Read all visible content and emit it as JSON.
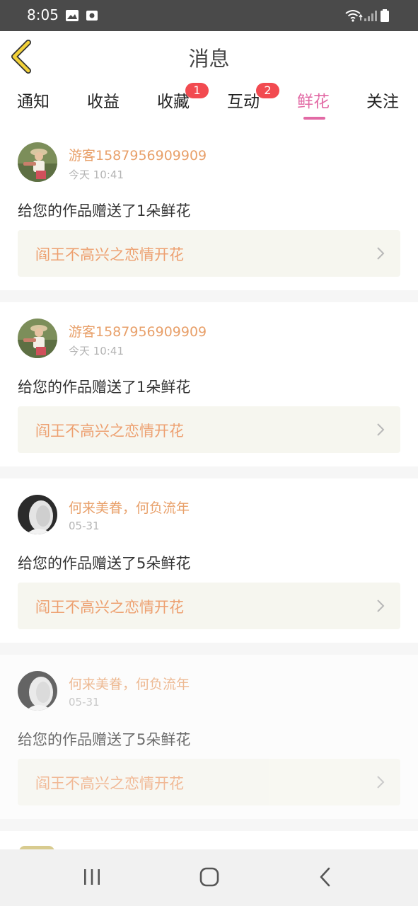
{
  "status_bar": {
    "time": "8:05"
  },
  "header": {
    "title": "消息"
  },
  "tabs": [
    {
      "label": "通知",
      "badge": null
    },
    {
      "label": "收益",
      "badge": null
    },
    {
      "label": "收藏",
      "badge": "1"
    },
    {
      "label": "互动",
      "badge": "2"
    },
    {
      "label": "鲜花",
      "badge": null,
      "active": true
    },
    {
      "label": "关注",
      "badge": null
    }
  ],
  "messages": [
    {
      "username": "游客1587956909909",
      "time": "今天 10:41",
      "text": "给您的作品赠送了1朵鲜花",
      "work_title": "阎王不高兴之恋情开花"
    },
    {
      "username": "游客1587956909909",
      "time": "今天 10:41",
      "text": "给您的作品赠送了1朵鲜花",
      "work_title": "阎王不高兴之恋情开花"
    },
    {
      "username": "何来美眷，何负流年",
      "time": "05-31",
      "text": "给您的作品赠送了5朵鲜花",
      "work_title": "阎王不高兴之恋情开花"
    },
    {
      "username": "何来美眷，何负流年",
      "time": "05-31",
      "text": "给您的作品赠送了5朵鲜花",
      "work_title": "阎王不高兴之恋情开花"
    }
  ],
  "colors": {
    "accent_pink": "#e26aa5",
    "username_orange": "#e8a06a",
    "badge_red": "#f24a50",
    "back_arrow_yellow": "#f3d23a"
  },
  "icons": {
    "back": "chevron-left-icon",
    "link_arrow": "chevron-right-icon",
    "nav_recents": "recents-icon",
    "nav_home": "home-icon",
    "nav_back": "back-icon"
  }
}
